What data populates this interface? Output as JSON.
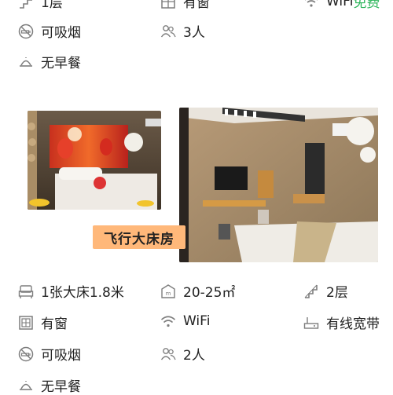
{
  "top_partial": {
    "floor": "1层",
    "window": "有窗",
    "wifi": "WiFi",
    "wifi_free": "免费",
    "smoking": "可吸烟",
    "guests": "3人",
    "breakfast": "无早餐"
  },
  "room": {
    "name": "飞行大床房",
    "bed": "1张大床1.8米",
    "area": "20-25㎡",
    "floor": "2层",
    "window": "有窗",
    "wifi": "WiFi",
    "broadband": "有线宽带",
    "smoking": "可吸烟",
    "guests": "2人",
    "breakfast": "无早餐"
  }
}
